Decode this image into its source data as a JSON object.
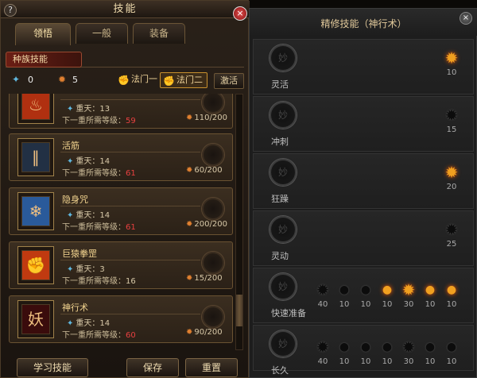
{
  "window": {
    "title": "技能",
    "help_label": "?",
    "close_label": "×"
  },
  "tabs": [
    "领悟",
    "一般",
    "装备"
  ],
  "race": {
    "label": "种族技能"
  },
  "points": {
    "blue": "0",
    "orange": "5"
  },
  "laws": [
    "法门一",
    "法门二"
  ],
  "activate_label": "激活",
  "tier_prefix": "重天：",
  "req_prefix": "下一重所需等级：",
  "skills": [
    {
      "name": "",
      "tier": "13",
      "req_level": "59",
      "progress": "110/200",
      "icon": "fire-skill-icon"
    },
    {
      "name": "活筋",
      "tier": "14",
      "req_level": "61",
      "progress": "60/200",
      "icon": "claw-skill-icon"
    },
    {
      "name": "隐身咒",
      "tier": "14",
      "req_level": "61",
      "progress": "200/200",
      "icon": "ice-skill-icon"
    },
    {
      "name": "巨猿拳罡",
      "tier": "3",
      "req_level": "16",
      "progress": "15/200",
      "icon": "fist-skill-icon"
    },
    {
      "name": "神行术",
      "tier": "14",
      "req_level": "60",
      "progress": "90/200",
      "icon": "swift-skill-icon"
    }
  ],
  "buttons": {
    "learn": "学习技能",
    "save": "保存",
    "reset": "重置"
  },
  "refine": {
    "title": "精修技能（神行术）",
    "close_label": "×",
    "rows": [
      {
        "name": "灵活",
        "nodes": [
          {
            "value": "10",
            "active": true
          }
        ]
      },
      {
        "name": "冲刺",
        "nodes": [
          {
            "value": "15",
            "active": false
          }
        ]
      },
      {
        "name": "狂躁",
        "nodes": [
          {
            "value": "20",
            "active": true
          }
        ]
      },
      {
        "name": "灵动",
        "nodes": [
          {
            "value": "25",
            "active": false
          }
        ]
      },
      {
        "name": "快速准备",
        "nodes": [
          {
            "value": "40",
            "active": false
          },
          {
            "value": "10",
            "active": false
          },
          {
            "value": "10",
            "active": false
          },
          {
            "value": "10",
            "active": true
          },
          {
            "value": "30",
            "active": true
          },
          {
            "value": "10",
            "active": true
          },
          {
            "value": "10",
            "active": true
          }
        ]
      },
      {
        "name": "长久",
        "nodes": [
          {
            "value": "40",
            "active": false
          },
          {
            "value": "10",
            "active": false
          },
          {
            "value": "10",
            "active": false
          },
          {
            "value": "10",
            "active": false
          },
          {
            "value": "30",
            "active": false
          },
          {
            "value": "10",
            "active": false
          },
          {
            "value": "10",
            "active": false
          }
        ]
      }
    ]
  },
  "colors": {
    "accent_gold": "#f0a020",
    "req_red": "#e84040",
    "panel_brown": "#2a2119",
    "refine_gray": "#1d1d1d"
  }
}
